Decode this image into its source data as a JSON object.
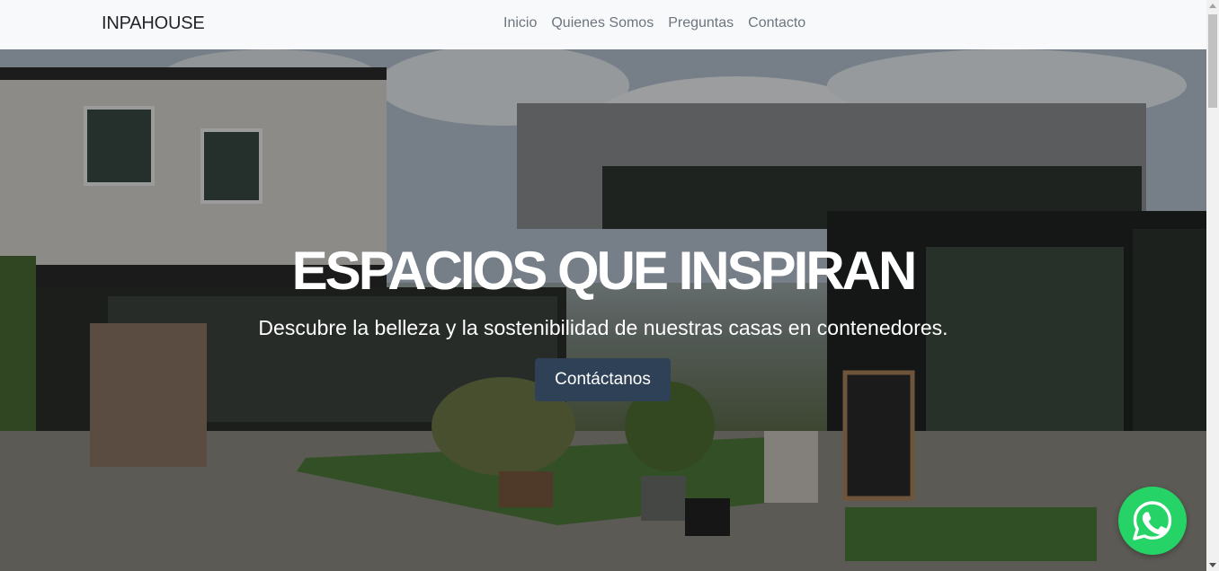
{
  "navbar": {
    "brand": "INPAHOUSE",
    "links": [
      "Inicio",
      "Quienes Somos",
      "Preguntas",
      "Contacto"
    ]
  },
  "hero": {
    "title": "ESPACIOS QUE INSPIRAN",
    "subtitle": "Descubre la belleza y la sostenibilidad de nuestras casas en contenedores.",
    "cta_label": "Contáctanos",
    "background": "container-houses-photo"
  },
  "floating": {
    "whatsapp_icon": "whatsapp-icon",
    "whatsapp_color": "#25d366"
  },
  "colors": {
    "cta_bg": "#2e4156",
    "nav_bg": "#f8f9fa"
  }
}
